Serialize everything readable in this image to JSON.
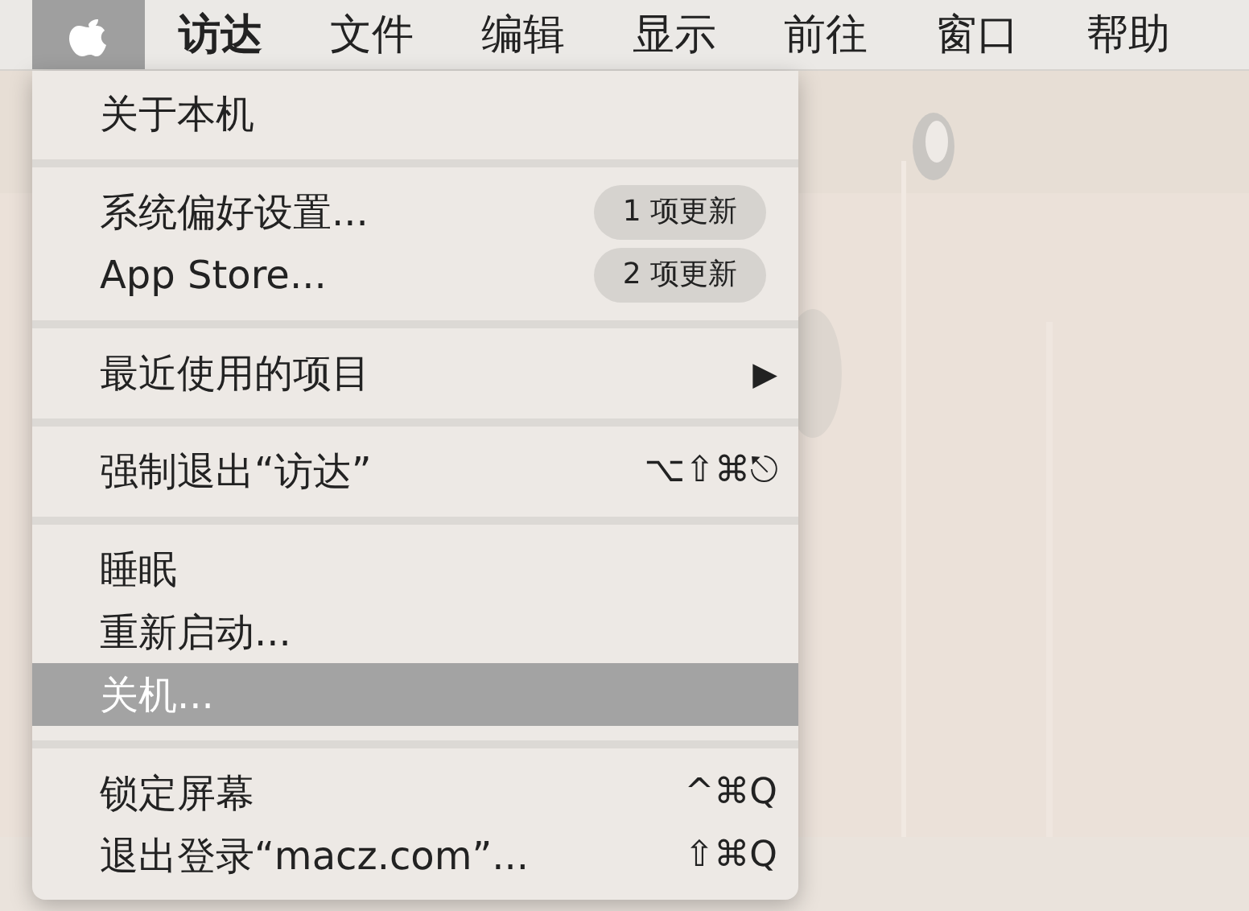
{
  "menubar": [
    {
      "kind": "apple",
      "selected": true
    },
    {
      "kind": "text",
      "label": "访达",
      "selected": false,
      "bold": true
    },
    {
      "kind": "text",
      "label": "文件",
      "selected": false,
      "bold": false
    },
    {
      "kind": "text",
      "label": "编辑",
      "selected": false,
      "bold": false
    },
    {
      "kind": "text",
      "label": "显示",
      "selected": false,
      "bold": false
    },
    {
      "kind": "text",
      "label": "前往",
      "selected": false,
      "bold": false
    },
    {
      "kind": "text",
      "label": "窗口",
      "selected": false,
      "bold": false
    },
    {
      "kind": "text",
      "label": "帮助",
      "selected": false,
      "bold": false
    }
  ],
  "menu": [
    {
      "kind": "item",
      "label": "关于本机",
      "selected": false
    },
    {
      "kind": "separator"
    },
    {
      "kind": "item",
      "label": "系统偏好设置...",
      "badge": "1 项更新",
      "selected": false
    },
    {
      "kind": "item",
      "label": "App Store...",
      "badge": "2 项更新",
      "selected": false
    },
    {
      "kind": "separator"
    },
    {
      "kind": "item",
      "label": "最近使用的项目",
      "submenu": "▶",
      "selected": false
    },
    {
      "kind": "separator"
    },
    {
      "kind": "item",
      "label": "强制退出“访达”",
      "shortcut": "⌥⇧⌘⎋",
      "selected": false
    },
    {
      "kind": "separator"
    },
    {
      "kind": "item",
      "label": "睡眠",
      "selected": false
    },
    {
      "kind": "item",
      "label": "重新启动...",
      "selected": false
    },
    {
      "kind": "item",
      "label": "关机...",
      "selected": true
    },
    {
      "kind": "separator"
    },
    {
      "kind": "item",
      "label": "锁定屏幕",
      "shortcut": "^⌘Q",
      "selected": false
    },
    {
      "kind": "item",
      "label": "退出登录“macz.com”...",
      "shortcut": "⇧⌘Q",
      "selected": false
    }
  ]
}
